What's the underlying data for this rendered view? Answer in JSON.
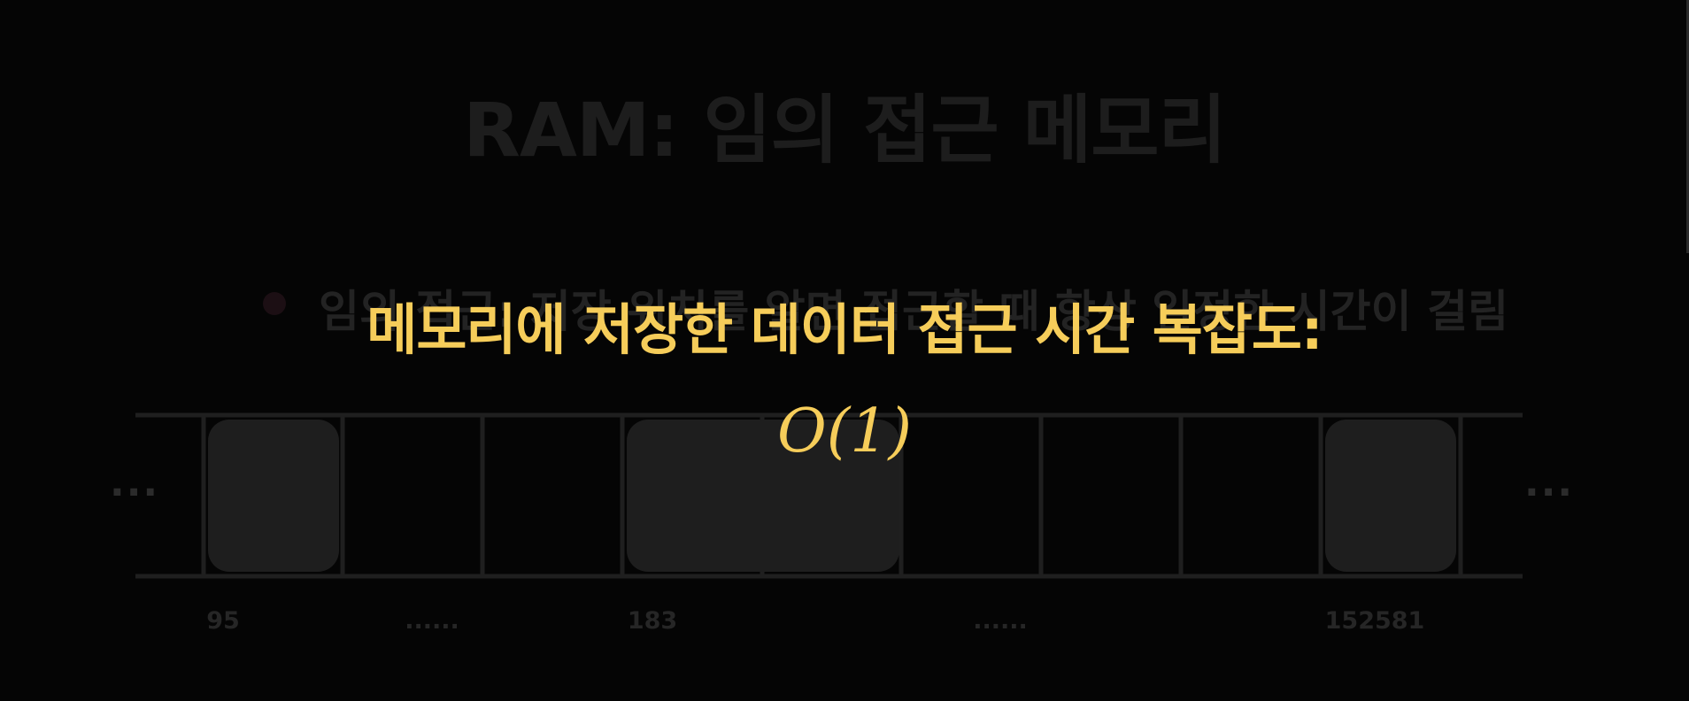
{
  "slide": {
    "title": "RAM: 임의 접근 메모리",
    "bullet": "임의 접근: 저장 위치를 알면 접근할 때 항상 일정한 시간이 걸림",
    "colors": {
      "background": "#050505",
      "highlight": "#f6cd5a",
      "dimmed_text": "#1d1d1d",
      "cell_border": "#1f1f1f",
      "cell_fill": "#1e1e1e"
    }
  },
  "memory": {
    "ellipsis_left": "...",
    "ellipsis_right": "...",
    "cells": [
      {
        "state": "filled"
      },
      {
        "state": "empty"
      },
      {
        "state": "empty"
      },
      {
        "state": "filled-start"
      },
      {
        "state": "filled-end"
      },
      {
        "state": "empty"
      },
      {
        "state": "empty"
      },
      {
        "state": "empty"
      },
      {
        "state": "filled"
      }
    ],
    "labels": [
      "95",
      "......",
      "183",
      "......",
      "152581"
    ]
  },
  "overlay": {
    "heading": "메모리에 저장한 데이터 접근 시간 복잡도:",
    "formula": "O(1)"
  }
}
